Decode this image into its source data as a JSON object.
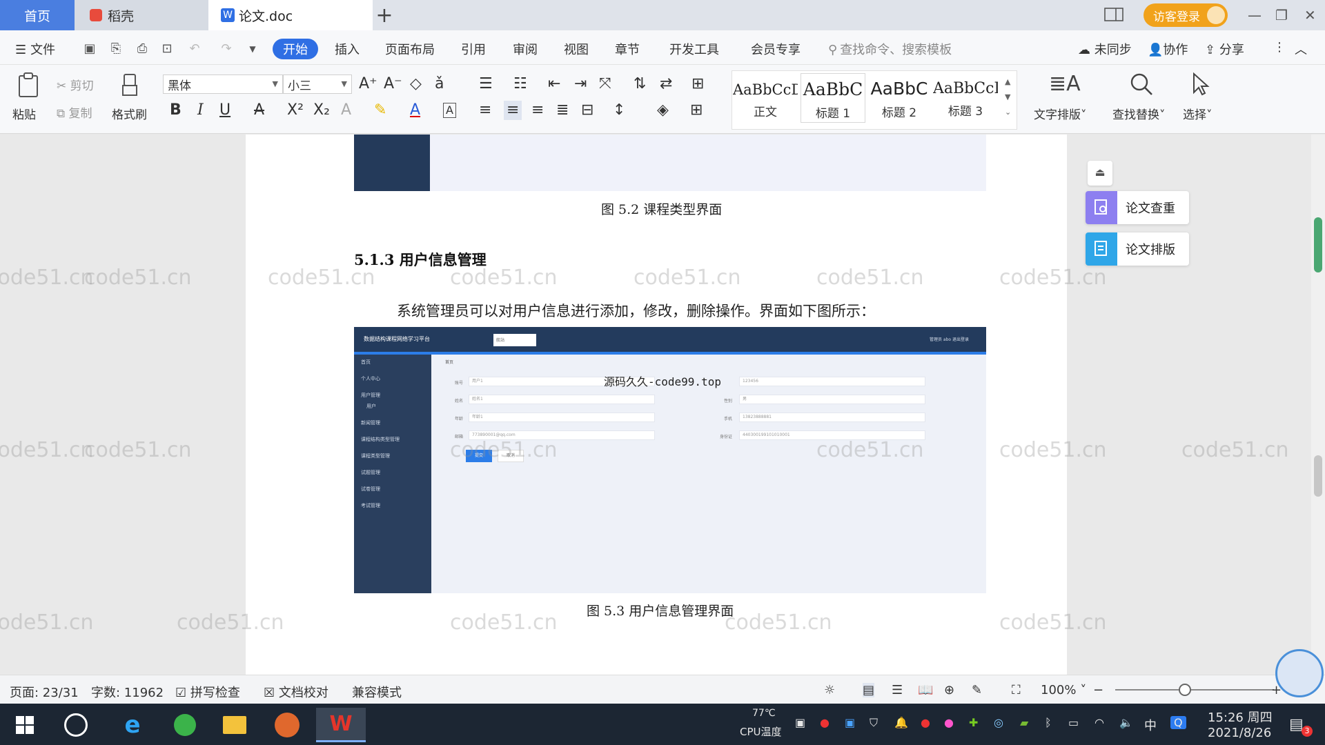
{
  "tabs": {
    "home": "首页",
    "daoke": "稻壳",
    "doc": "论文.doc",
    "add": "+"
  },
  "window": {
    "login": "访客登录"
  },
  "menu": {
    "file": "文件",
    "start": "开始",
    "insert": "插入",
    "layout": "页面布局",
    "reference": "引用",
    "review": "审阅",
    "view": "视图",
    "chapter": "章节",
    "devtools": "开发工具",
    "vip": "会员专享",
    "search_placeholder": "查找命令、搜索模板",
    "unsync": "未同步",
    "collab": "协作",
    "share": "分享"
  },
  "ribbon": {
    "paste": "粘贴",
    "cut": "剪切",
    "copy": "复制",
    "format_painter": "格式刷",
    "font": "黑体",
    "size": "小三",
    "styles": [
      {
        "sample": "AaBbCcDd",
        "name": "正文"
      },
      {
        "sample": "AaBbC",
        "name": "标题 1"
      },
      {
        "sample": "AaBbC",
        "name": "标题 2"
      },
      {
        "sample": "AaBbCcI",
        "name": "标题 3"
      }
    ],
    "text_layout": "文字排版",
    "find_replace": "查找替换",
    "select": "选择"
  },
  "document": {
    "caption_52": "图 5.2  课程类型界面",
    "heading": "5.1.3  用户信息管理",
    "paragraph": "系统管理员可以对用户信息进行添加，修改，删除操作。界面如下图所示：",
    "caption_53": "图 5.3  用户信息管理界面",
    "figure": {
      "app_title": "数据结构课程网络学习平台",
      "top_select": "航站",
      "top_right": "管理员 abo    退出登录",
      "watermark": "源码久久-code99.top",
      "breadcrumb": "首页",
      "menu": [
        "首页",
        "个人中心",
        "用户管理",
        "用户",
        "新闻管理",
        "课程结构类型管理",
        "课程类型管理",
        "试题管理",
        "试卷管理",
        "考试管理"
      ],
      "fields": {
        "account": "账号",
        "account_v": "用户1",
        "password_v": "123456",
        "name": "姓名",
        "name_v": "姓名1",
        "gender": "性别",
        "gender_v": "男",
        "age": "年龄",
        "age_v": "年龄1",
        "phone": "手机",
        "phone_v": "13823888881",
        "email": "邮箱",
        "email_v": "773890001@qq.com",
        "idcard": "身份证",
        "idcard_v": "440300199101010001"
      },
      "submit": "提交",
      "cancel": "取消"
    },
    "watermark_text": "code51.cn"
  },
  "side_panel": {
    "check": "论文查重",
    "format": "论文排版"
  },
  "status": {
    "page": "页面: 23/31",
    "words": "字数: 11962",
    "spell": "拼写检查",
    "doc_check": "文档校对",
    "compat": "兼容模式",
    "zoom": "100%"
  },
  "taskbar": {
    "temp": "77℃",
    "cpu": "CPU温度",
    "ime": "中",
    "time": "15:26 周四",
    "date": "2021/8/26",
    "notif": "3"
  }
}
